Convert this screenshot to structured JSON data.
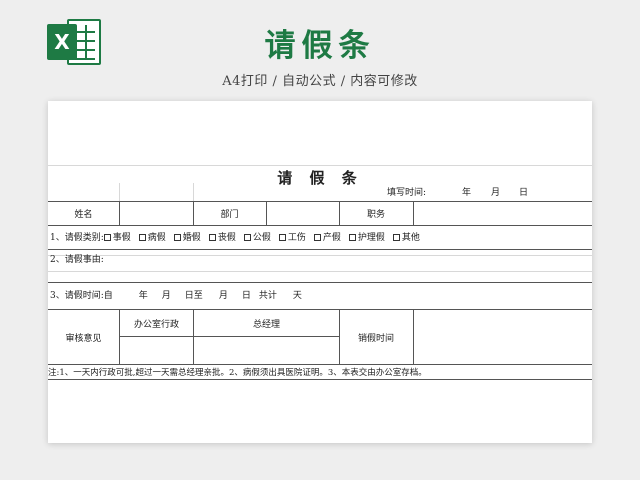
{
  "header": {
    "title": "请假条",
    "subtitle": "A4打印 / 自动公式 / 内容可修改",
    "logo_icon": "excel-icon",
    "logo_letter": "X",
    "accent": "#1e7a44"
  },
  "form": {
    "title": "请 假 条",
    "fill_time": {
      "label": "填写时间:",
      "year": "年",
      "month": "月",
      "day": "日"
    },
    "row_name": {
      "name_label": "姓名",
      "dept_label": "部门",
      "position_label": "职务"
    },
    "leave_type": {
      "label": "1、请假类别:",
      "options": [
        "事假",
        "病假",
        "婚假",
        "丧假",
        "公假",
        "工伤",
        "产假",
        "护理假",
        "其他"
      ]
    },
    "reason_label": "2、请假事由:",
    "time_row": {
      "label": "3、请假时间:自",
      "year": "年",
      "month": "月",
      "day_to": "日至",
      "month2": "月",
      "day2": "日",
      "total": "共计",
      "days": "天"
    },
    "approval": {
      "label": "审核意见",
      "office": "办公室行政",
      "manager": "总经理",
      "cancel_time": "销假时间"
    },
    "note": "注:1、一天内行政可批,超过一天需总经理亲批。2、病假须出具医院证明。3、本表交由办公室存档。"
  }
}
